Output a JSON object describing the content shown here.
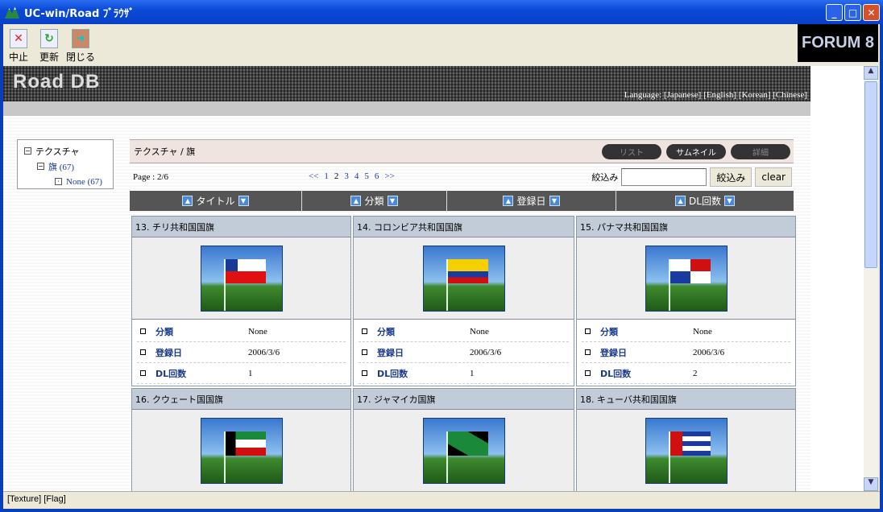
{
  "window": {
    "title": "UC-win/Road ﾌﾞﾗｳｻﾞ"
  },
  "toolbar": {
    "stop": "中止",
    "refresh": "更新",
    "close": "閉じる",
    "logo": "FORUM 8"
  },
  "site": {
    "logo": "Road DB",
    "language": "Language: [Japanese]  [English]  [Korean]  [Chinese]"
  },
  "tree": [
    {
      "label": "テクスチャ"
    },
    {
      "label": "旗 (67)"
    },
    {
      "label": "None (67)"
    }
  ],
  "breadcrumb": "テクスチャ / 旗",
  "views": {
    "list": "リスト",
    "thumb": "サムネイル",
    "detail": "詳細"
  },
  "pager": {
    "label": "Page : 2/6",
    "prev": "<<",
    "pages": [
      "1",
      "2",
      "3",
      "4",
      "5",
      "6"
    ],
    "next": ">>"
  },
  "filter": {
    "label": "絞込み",
    "value": "",
    "button": "絞込み",
    "clear": "clear"
  },
  "sort": [
    "タイトル",
    "分類",
    "登録日",
    "DL回数"
  ],
  "fields": {
    "category": "分類",
    "date": "登録日",
    "dl": "DL回数"
  },
  "cards": [
    {
      "title": "13. チリ共和国国旗",
      "category": "None",
      "date": "2006/3/6",
      "dl": "1",
      "flag": "chile"
    },
    {
      "title": "14. コロンビア共和国国旗",
      "category": "None",
      "date": "2006/3/6",
      "dl": "1",
      "flag": "colombia"
    },
    {
      "title": "15. パナマ共和国国旗",
      "category": "None",
      "date": "2006/3/6",
      "dl": "2",
      "flag": "panama"
    },
    {
      "title": "16. クウェート国国旗",
      "flag": "kuwait"
    },
    {
      "title": "17. ジャマイカ国旗",
      "flag": "jamaica"
    },
    {
      "title": "18. キューバ共和国国旗",
      "flag": "cuba"
    }
  ],
  "status": "[Texture] [Flag]"
}
